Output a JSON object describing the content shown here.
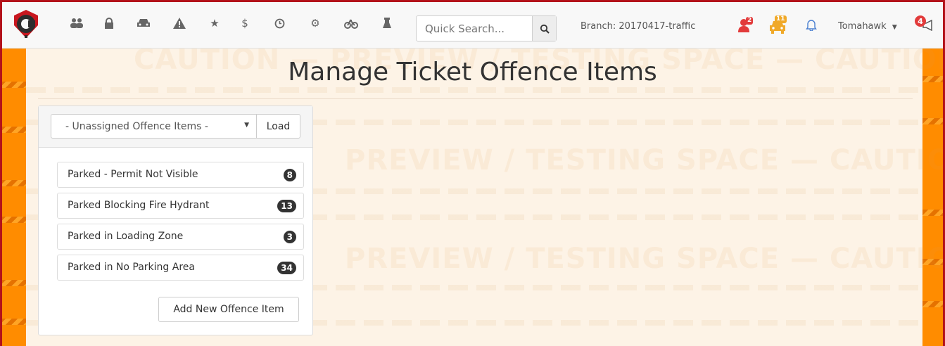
{
  "navbar": {
    "icons": [
      {
        "name": "users-icon",
        "glyph": "👥"
      },
      {
        "name": "lock-icon",
        "glyph": "🔒"
      },
      {
        "name": "car-icon",
        "glyph": "🚗"
      },
      {
        "name": "warning-icon",
        "glyph": "▲"
      },
      {
        "name": "star-icon",
        "glyph": "★"
      },
      {
        "name": "dollar-icon",
        "glyph": "$"
      },
      {
        "name": "clock-icon",
        "glyph": "⊙"
      },
      {
        "name": "settings-icon",
        "glyph": "⚙"
      },
      {
        "name": "bicycle-icon",
        "glyph": "⚆"
      },
      {
        "name": "lab-icon",
        "glyph": "⚗"
      }
    ],
    "search": {
      "placeholder": "Quick Search...",
      "value": ""
    },
    "branch": "Branch: 20170417-traffic",
    "alerts": {
      "user_alert_count": "2",
      "vehicle_alert_count": "11",
      "announcement_count": "4"
    },
    "user": "Tomahawk",
    "colors": {
      "alert_red": "#e23b3b",
      "alert_orange": "#f0a929",
      "frame": "#b3121a",
      "stripe": "#ff8c00"
    }
  },
  "page": {
    "title": "Manage Ticket Offence Items",
    "watermark_rows": [
      "CAUTION  —  PREVIEW / TESTING SPACE  —  CAUTION",
      "PREVIEW / TESTING SPACE  —  CAUTION",
      "PREVIEW / TESTING SPACE  —  CAUTION"
    ]
  },
  "panel": {
    "select_value": "- Unassigned Offence Items -",
    "load_label": "Load",
    "items": [
      {
        "label": "Parked - Permit Not Visible",
        "count": "8"
      },
      {
        "label": "Parked Blocking Fire Hydrant",
        "count": "13"
      },
      {
        "label": "Parked in Loading Zone",
        "count": "3"
      },
      {
        "label": "Parked in No Parking Area",
        "count": "34"
      }
    ],
    "add_label": "Add New Offence Item"
  }
}
